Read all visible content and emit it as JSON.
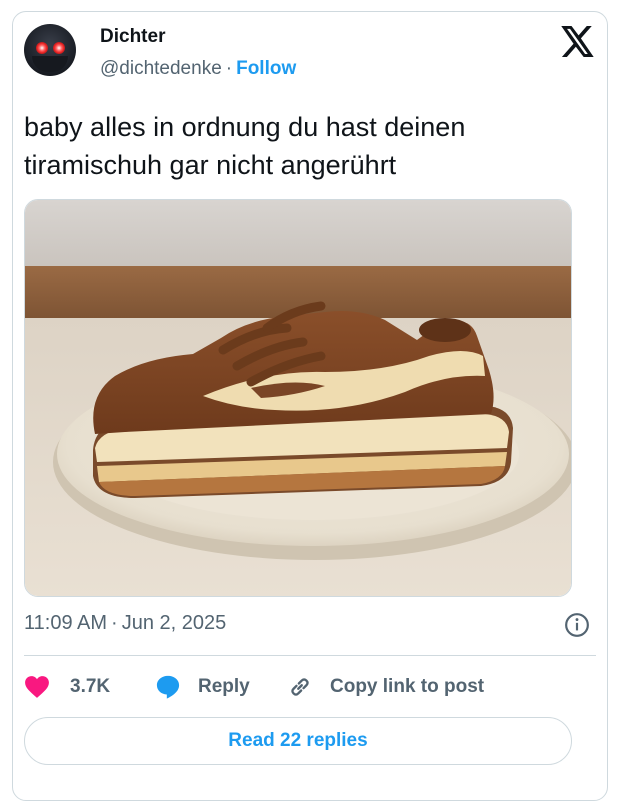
{
  "author": {
    "name": "Dichter",
    "handle": "@dichtedenke",
    "separator": "·",
    "follow_label": "Follow",
    "avatar_icon": "dark-figure-red-eyes-avatar"
  },
  "brand_icon": "x-logo-icon",
  "tweet": {
    "line1": "baby alles in ordnung du hast deinen",
    "line2": "tiramischuh gar nicht angerührt"
  },
  "media": {
    "subject_icon": "tiramisu-sneaker-on-plate-image"
  },
  "meta": {
    "time": "11:09 AM",
    "separator": "·",
    "date": "Jun 2, 2025",
    "info_icon": "info-icon"
  },
  "actions": {
    "like_count": "3.7K",
    "reply_label": "Reply",
    "copy_label": "Copy link to post"
  },
  "replies_button": "Read 22 replies",
  "colors": {
    "accent": "#1d9bf0",
    "like": "#f91880",
    "text": "#0f1419",
    "secondary": "#536471",
    "border": "#cfd9de"
  }
}
